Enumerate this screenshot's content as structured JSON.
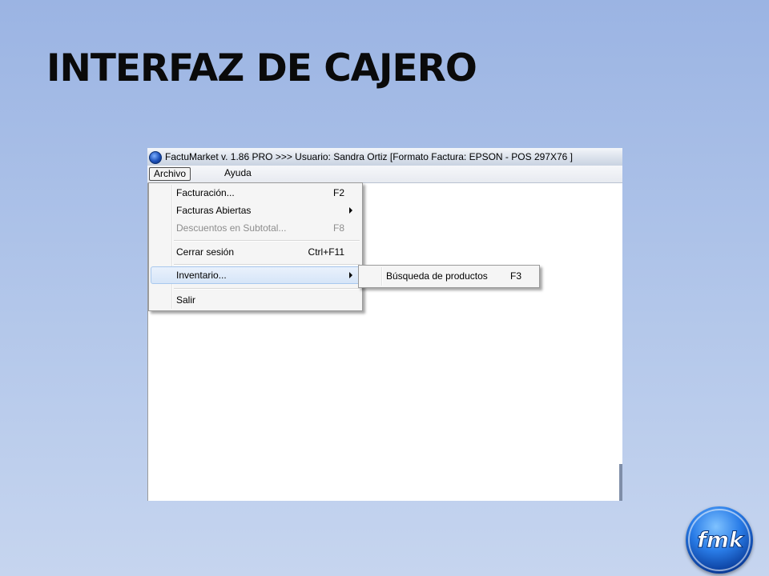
{
  "slide": {
    "title": "INTERFAZ DE CAJERO"
  },
  "window": {
    "title": "FactuMarket v. 1.86 PRO >>>  Usuario: Sandra Ortiz [Formato Factura: EPSON - POS 297X76 ]",
    "menubar": [
      {
        "label": "Archivo",
        "active": true
      },
      {
        "label": "Ayuda",
        "active": false
      }
    ]
  },
  "archivo_menu": {
    "items": [
      {
        "label": "Facturación...",
        "shortcut": "F2",
        "enabled": true
      },
      {
        "label": "Facturas Abiertas",
        "shortcut": "",
        "submenu": true,
        "enabled": true
      },
      {
        "label": "Descuentos en Subtotal...",
        "shortcut": "F8",
        "enabled": false
      },
      {
        "label": "Cerrar sesión",
        "shortcut": "Ctrl+F11",
        "enabled": true
      },
      {
        "label": "Inventario...",
        "shortcut": "",
        "submenu": true,
        "enabled": true,
        "highlighted": true
      },
      {
        "label": "Salir",
        "shortcut": "",
        "enabled": true
      }
    ]
  },
  "inventario_submenu": {
    "items": [
      {
        "label": "Búsqueda de productos",
        "shortcut": "F3"
      }
    ]
  },
  "logo": {
    "icon": "fmk-logo",
    "text": "fmk"
  },
  "colors": {
    "background_top": "#9bb4e3",
    "background_bottom": "#c6d5ef",
    "highlight": "#d6e5f8",
    "logo_blue": "#2a7de8"
  }
}
